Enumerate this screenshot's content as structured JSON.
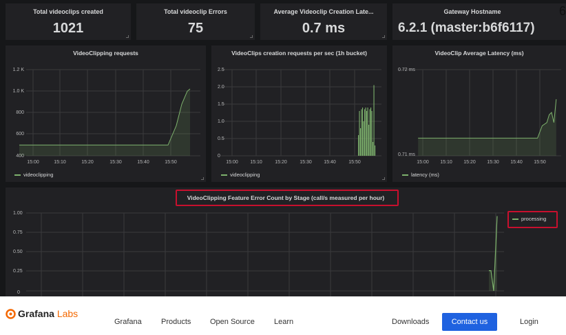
{
  "stats": [
    {
      "title": "Total videoclips created",
      "value": "1021"
    },
    {
      "title": "Total videoclip Errors",
      "value": "75"
    },
    {
      "title": "Average Videoclip Creation Late...",
      "value": "0.7 ms"
    },
    {
      "title": "Gateway Hostname",
      "value": "6.2.1 (master:b6f6117)"
    }
  ],
  "edge_digits": [
    "6",
    "7"
  ],
  "panels": {
    "requests": {
      "title": "VideoClipping requests",
      "legend": "videoclipping"
    },
    "rate": {
      "title": "VideoClips creation requests per sec (1h bucket)",
      "legend": "videoclipping"
    },
    "latency": {
      "title": "VideoClip Average Latency (ms)",
      "legend": "latency (ms)"
    },
    "errors": {
      "title": "VideoClipping Feature Error Count by Stage (call/s measured per hour)",
      "legend": "processing"
    }
  },
  "colors": {
    "series": "#7eb26d",
    "highlight": "#c8102e",
    "accent": "#f46800",
    "button": "#1f62e0"
  },
  "chart_data": [
    {
      "type": "line",
      "title": "VideoClipping requests",
      "x": [
        "15:00",
        "15:10",
        "15:20",
        "15:30",
        "15:40",
        "15:50"
      ],
      "y_ticks": [
        "400",
        "600",
        "800",
        "1.0 K",
        "1.2 K"
      ],
      "ylim": [
        400,
        1200
      ],
      "series": [
        {
          "name": "videoclipping",
          "points": [
            [
              "14:55",
              500
            ],
            [
              "15:49",
              500
            ],
            [
              "15:52",
              680
            ],
            [
              "15:54",
              880
            ],
            [
              "15:56",
              1000
            ],
            [
              "15:57",
              1021
            ]
          ]
        }
      ]
    },
    {
      "type": "bar",
      "title": "VideoClips creation requests per sec (1h bucket)",
      "x": [
        "15:00",
        "15:10",
        "15:20",
        "15:30",
        "15:40",
        "15:50"
      ],
      "y_ticks": [
        "0",
        "0.5",
        "1.0",
        "1.5",
        "2.0",
        "2.5"
      ],
      "ylim": [
        0,
        2.5
      ],
      "series": [
        {
          "name": "videoclipping",
          "values": [
            0.6,
            1.3,
            0.8,
            1.35,
            1.4,
            1.0,
            1.35,
            1.4,
            1.3,
            1.4,
            0.9,
            1.35,
            1.4,
            1.3,
            0.4,
            2.05,
            0.3
          ]
        }
      ]
    },
    {
      "type": "line",
      "title": "VideoClip Average Latency (ms)",
      "x": [
        "15:00",
        "15:10",
        "15:20",
        "15:30",
        "15:40",
        "15:50"
      ],
      "y_ticks": [
        "0.71 ms",
        "0.72 ms"
      ],
      "ylim": [
        0.71,
        0.72
      ],
      "series": [
        {
          "name": "latency (ms)",
          "points": [
            [
              "14:58",
              0.7112
            ],
            [
              "15:49",
              0.7112
            ],
            [
              "15:51",
              0.7128
            ],
            [
              "15:53",
              0.7132
            ],
            [
              "15:54",
              0.7142
            ],
            [
              "15:55",
              0.7145
            ],
            [
              "15:56",
              0.7132
            ],
            [
              "15:57",
              0.7162
            ]
          ]
        }
      ]
    },
    {
      "type": "line",
      "title": "VideoClipping Feature Error Count by Stage (call/s measured per hour)",
      "y_ticks": [
        "0",
        "0.25",
        "0.50",
        "0.75",
        "1.00"
      ],
      "ylim": [
        0,
        1.0
      ],
      "series": [
        {
          "name": "processing",
          "values": [
            0.26,
            0.26,
            0,
            0.96
          ]
        }
      ]
    }
  ],
  "footer": {
    "logo_main": "Grafana",
    "logo_labs": "Labs",
    "nav": [
      "Grafana",
      "Products",
      "Open Source",
      "Learn"
    ],
    "downloads": "Downloads",
    "contact": "Contact us",
    "login": "Login"
  }
}
